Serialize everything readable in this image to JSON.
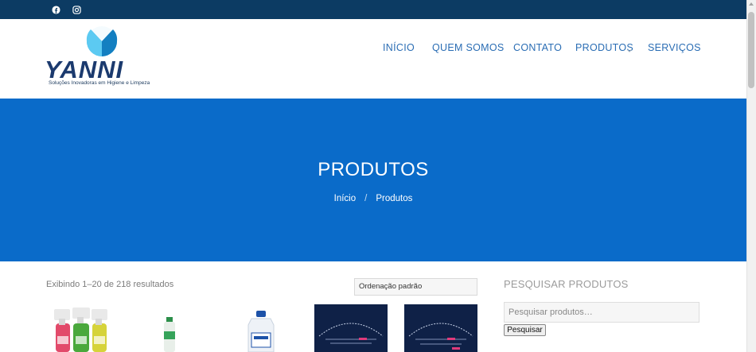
{
  "topbar": {
    "social": [
      {
        "name": "facebook-icon"
      },
      {
        "name": "instagram-icon"
      }
    ]
  },
  "logo": {
    "wordmark": "YANNI",
    "subtitle": "Soluções Inovadoras em Higiene e Limpeza"
  },
  "nav": {
    "items": [
      {
        "label": "INÍCIO"
      },
      {
        "label": "QUEM SOMOS"
      },
      {
        "label": "CONTATO"
      },
      {
        "label": "PRODUTOS"
      },
      {
        "label": "SERVIÇOS"
      }
    ]
  },
  "hero": {
    "title": "PRODUTOS",
    "breadcrumb": {
      "home": "Início",
      "separator": "/",
      "current": "Produtos"
    },
    "background": "#0a6bc9"
  },
  "shop": {
    "results_text": "Exibindo 1–20 de 218 resultados",
    "sort_label": "Ordenação padrão"
  },
  "sidebar": {
    "title": "PESQUISAR PRODUTOS",
    "search_placeholder": "Pesquisar produtos…",
    "search_button": "Pesquisar"
  },
  "colors": {
    "topbar": "#0c3b63",
    "accent": "#2a6db4",
    "hero": "#0a6bc9"
  }
}
